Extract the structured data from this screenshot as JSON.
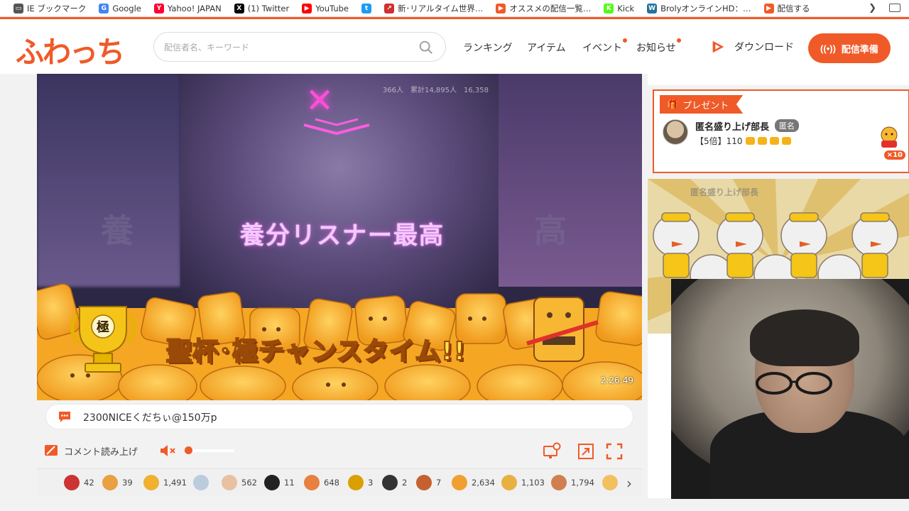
{
  "bookmarks": [
    {
      "label": "IE ブックマーク",
      "icon": "folder-icon",
      "color": "#555555"
    },
    {
      "label": "Google",
      "icon": "google-icon",
      "color": "#4285f4"
    },
    {
      "label": "Yahoo! JAPAN",
      "icon": "yahoo-icon",
      "color": "#ff0033"
    },
    {
      "label": "(1) Twitter",
      "icon": "x-icon",
      "color": "#000000"
    },
    {
      "label": "YouTube",
      "icon": "youtube-icon",
      "color": "#ff0000"
    },
    {
      "label": "",
      "icon": "twitter-bird-icon",
      "color": "#1d9bf0"
    },
    {
      "label": "新･リアルタイム世界…",
      "icon": "chart-icon",
      "color": "#d0302f"
    },
    {
      "label": "オススメの配信一覧…",
      "icon": "fuwatch-icon",
      "color": "#f05a28"
    },
    {
      "label": "Kick",
      "icon": "kick-icon",
      "color": "#53fc18"
    },
    {
      "label": "BrolyオンラインHD：…",
      "icon": "wordpress-icon",
      "color": "#21759b"
    },
    {
      "label": "配信する",
      "icon": "fuwatch-icon",
      "color": "#f05a28"
    }
  ],
  "header": {
    "logo": "ふわっち",
    "search_placeholder": "配信者名、キーワード",
    "nav": [
      "ランキング",
      "アイテム",
      "イベント",
      "お知らせ"
    ],
    "download": "ダウンロード",
    "live_button": "配信準備",
    "accent": "#f05a28"
  },
  "video": {
    "stats": "366人　累計14,895人　16,358",
    "caption": "養分リスナー最高",
    "banner": "聖杯･極チャンスタイム!!",
    "trophy_label": "極",
    "timer": "2:26:49"
  },
  "comment": {
    "value": "2300NICEくだちぃ@150万p"
  },
  "controls": {
    "readout_label": "コメント読み上げ",
    "volume_percent": 2
  },
  "items": [
    {
      "icon": "ninja-icon",
      "count": "42",
      "color": "#c33"
    },
    {
      "icon": "monkey-icon",
      "count": "39",
      "color": "#e8a040"
    },
    {
      "icon": "hammer-icon",
      "count": "1,491",
      "color": "#f0b030"
    },
    {
      "icon": "bowl-icon",
      "count": "",
      "color": "#bcd"
    },
    {
      "icon": "pig-icon",
      "count": "562",
      "color": "#e9c0a0"
    },
    {
      "icon": "bomb-icon",
      "count": "11",
      "color": "#222"
    },
    {
      "icon": "pizza-icon",
      "count": "648",
      "color": "#e88040"
    },
    {
      "icon": "trophy-icon",
      "count": "3",
      "color": "#d9a000"
    },
    {
      "icon": "bag-icon",
      "count": "2",
      "color": "#333"
    },
    {
      "icon": "samurai-icon",
      "count": "7",
      "color": "#c56030"
    },
    {
      "icon": "bread-icon",
      "count": "2,634",
      "color": "#f0a030"
    },
    {
      "icon": "bread-gold-icon",
      "count": "1,103",
      "color": "#e8b040"
    },
    {
      "icon": "crown-bear-icon",
      "count": "1,794",
      "color": "#d08050"
    },
    {
      "icon": "cake-icon",
      "count": "",
      "color": "#f3c060"
    }
  ],
  "present": {
    "tag": "プレゼント",
    "name": "匿名盛り上げ部長",
    "badge": "匿名",
    "message": "【5倍】110",
    "count": "×10"
  },
  "effect": {
    "name": "匿名盛り上げ部長"
  }
}
